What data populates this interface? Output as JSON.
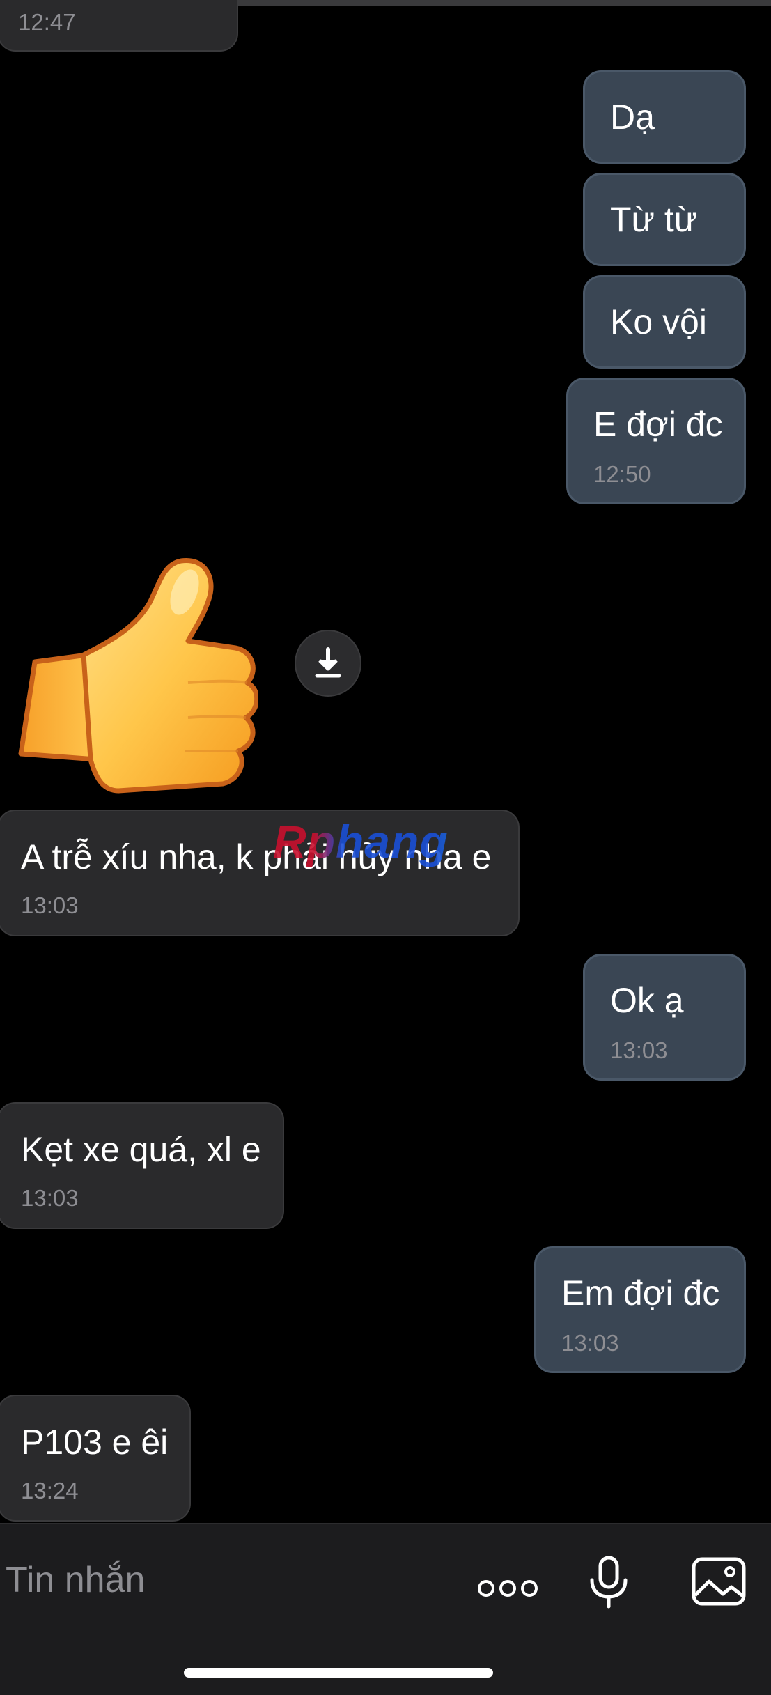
{
  "composer": {
    "placeholder": "Tin nhắn",
    "more_icon": "more-dots-icon",
    "mic_icon": "microphone-icon",
    "image_icon": "image-icon"
  },
  "messages": [
    {
      "direction": "incoming",
      "text": "",
      "time": "12:47"
    },
    {
      "direction": "outgoing",
      "text": "Dạ",
      "time": ""
    },
    {
      "direction": "outgoing",
      "text": "Từ từ",
      "time": ""
    },
    {
      "direction": "outgoing",
      "text": "Ko vội",
      "time": ""
    },
    {
      "direction": "outgoing",
      "text": "E đợi đc",
      "time": "12:50"
    },
    {
      "direction": "incoming",
      "type": "sticker",
      "sticker": "thumbs-up-sticker"
    },
    {
      "direction": "incoming",
      "text": "A trễ xíu nha, k phải hủy nha e",
      "time": "13:03"
    },
    {
      "direction": "outgoing",
      "text": "Ok ạ",
      "time": "13:03"
    },
    {
      "direction": "incoming",
      "text": "Kẹt xe quá, xl e",
      "time": "13:03"
    },
    {
      "direction": "outgoing",
      "text": "Em đợi đc",
      "time": "13:03"
    },
    {
      "direction": "incoming",
      "text": "P103 e êi",
      "time": "13:24"
    }
  ],
  "watermark": "Rphang",
  "colors": {
    "background": "#000000",
    "incoming_bubble": "#2a2a2c",
    "outgoing_bubble": "#3a4654",
    "time_text": "#8e8e93"
  }
}
